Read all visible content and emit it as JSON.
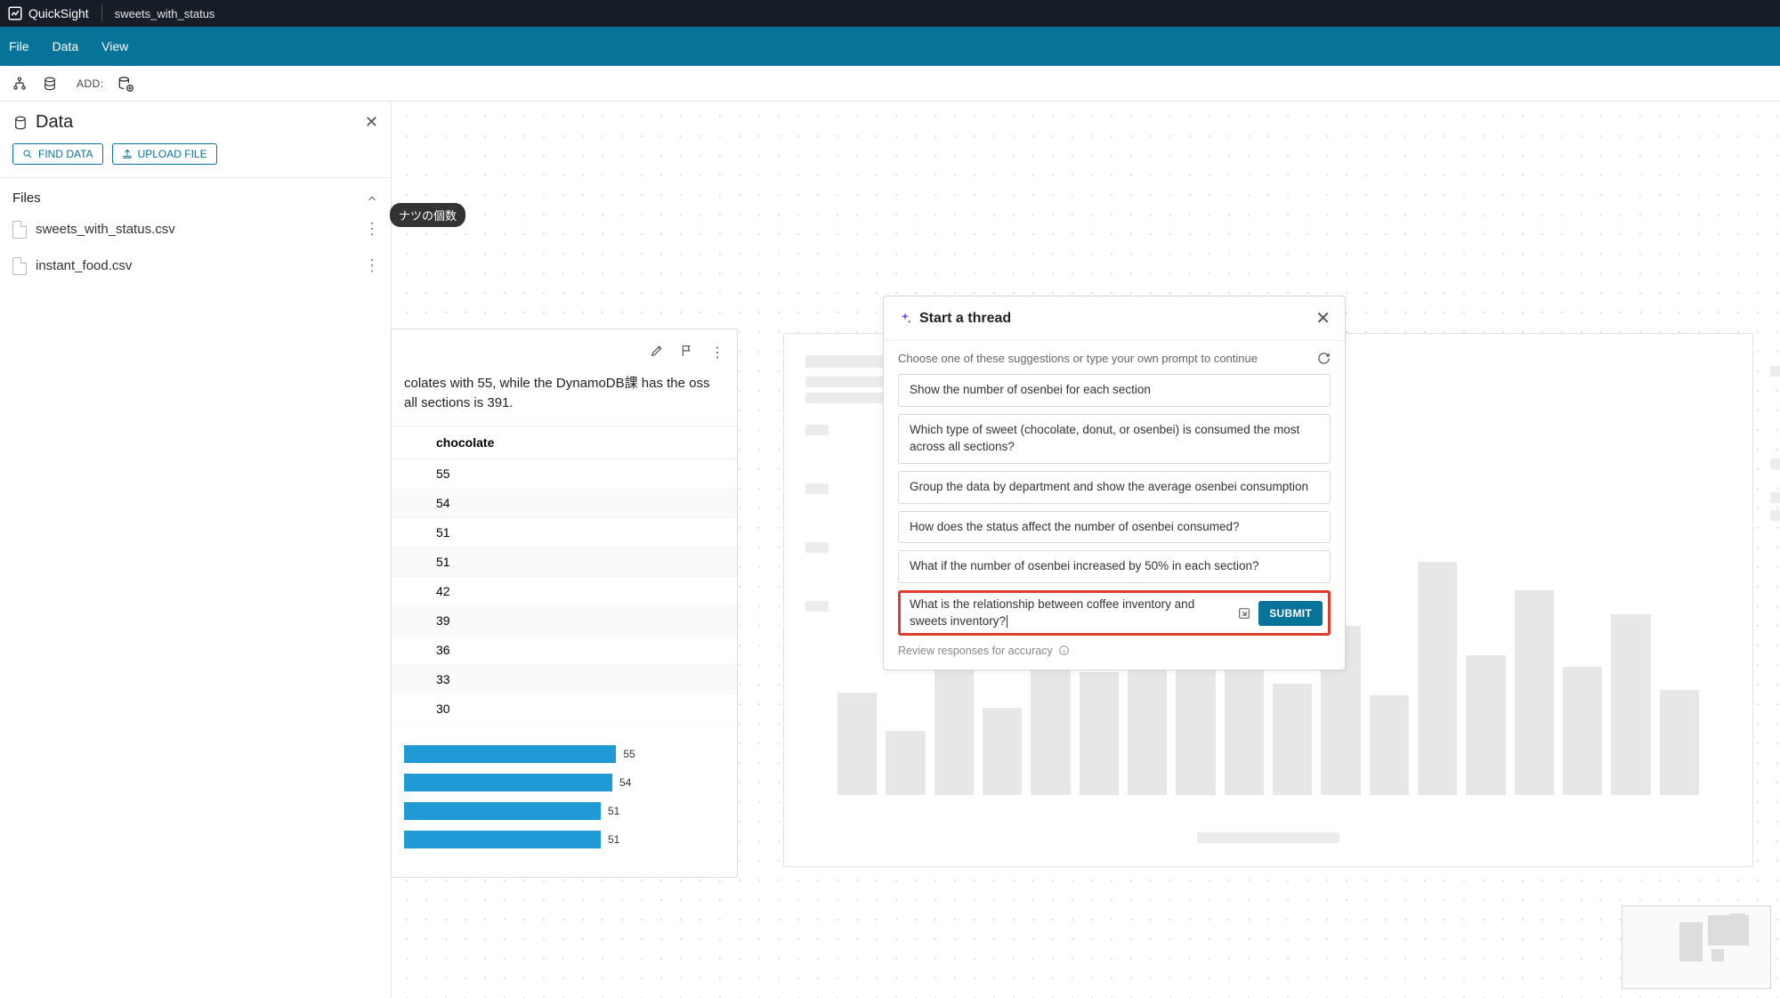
{
  "app": {
    "name": "QuickSight",
    "document": "sweets_with_status"
  },
  "menubar": [
    "File",
    "Data",
    "View"
  ],
  "toolbar": {
    "add_label": "ADD:"
  },
  "left_panel": {
    "title": "Data",
    "find_btn": "FIND DATA",
    "upload_btn": "UPLOAD FILE",
    "files_header": "Files",
    "files": [
      "sweets_with_status.csv",
      "instant_food.csv"
    ]
  },
  "tooltip_chip": "ナツの個数",
  "visual_card": {
    "summary": "colates with 55, while the DynamoDB課 has the oss all sections is 391.",
    "table": {
      "header": "chocolate",
      "rows": [
        55,
        54,
        51,
        51,
        42,
        39,
        36,
        33,
        30
      ]
    }
  },
  "chart_data": {
    "type": "bar",
    "orientation": "horizontal",
    "title": "",
    "xlabel": "",
    "ylabel": "",
    "xlim": [
      0,
      60
    ],
    "series": [
      {
        "name": "chocolate",
        "values": [
          55,
          54,
          51,
          51
        ]
      }
    ]
  },
  "modal": {
    "title": "Start a thread",
    "instruction": "Choose one of these suggestions or type your own prompt to continue",
    "suggestions": [
      "Show the number of osenbei for each section",
      "Which type of sweet (chocolate, donut, or osenbei) is consumed the most across all sections?",
      "Group the data by department and show the average osenbei consumption",
      "How does the status affect the number of osenbei consumed?",
      "What if the number of osenbei increased by 50% in each section?"
    ],
    "prompt_value": "What is the relationship between coffee inventory and sweets inventory?",
    "submit": "SUBMIT",
    "review": "Review responses for accuracy"
  }
}
